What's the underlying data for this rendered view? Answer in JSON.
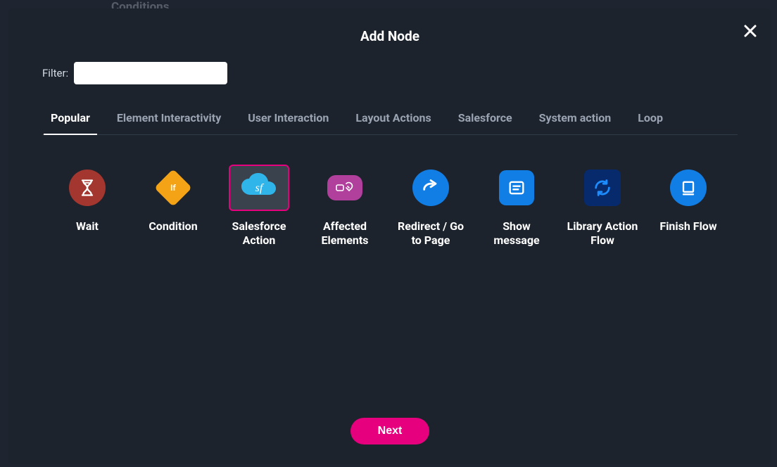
{
  "background": {
    "partial_label": "Conditions"
  },
  "modal": {
    "title": "Add Node",
    "filter_label": "Filter:",
    "filter_value": "",
    "filter_placeholder": "",
    "close_aria": "Close"
  },
  "tabs": {
    "items": [
      {
        "label": "Popular",
        "active": true
      },
      {
        "label": "Element Interactivity",
        "active": false
      },
      {
        "label": "User Interaction",
        "active": false
      },
      {
        "label": "Layout Actions",
        "active": false
      },
      {
        "label": "Salesforce",
        "active": false
      },
      {
        "label": "System action",
        "active": false
      },
      {
        "label": "Loop",
        "active": false
      }
    ]
  },
  "nodes": {
    "items": [
      {
        "id": "wait",
        "label": "Wait",
        "selected": false
      },
      {
        "id": "condition",
        "label": "Condition",
        "selected": false
      },
      {
        "id": "salesforce-action",
        "label": "Salesforce Action",
        "selected": true
      },
      {
        "id": "affected-elements",
        "label": "Affected Elements",
        "selected": false
      },
      {
        "id": "redirect",
        "label": "Redirect / Go to Page",
        "selected": false
      },
      {
        "id": "show-message",
        "label": "Show message",
        "selected": false
      },
      {
        "id": "library-action-flow",
        "label": "Library Action Flow",
        "selected": false
      },
      {
        "id": "finish-flow",
        "label": "Finish Flow",
        "selected": false
      }
    ]
  },
  "buttons": {
    "next": "Next"
  },
  "colors": {
    "background": "#1e2530",
    "modal": "#1c232d",
    "accent": "#e6007e",
    "tab_border": "#313a47",
    "blue": "#117ee6",
    "cloud": "#2fb5ea",
    "orange": "#f4a316",
    "brick": "#a3362e",
    "purple": "#b0409c",
    "darkblue": "#062a6c"
  }
}
